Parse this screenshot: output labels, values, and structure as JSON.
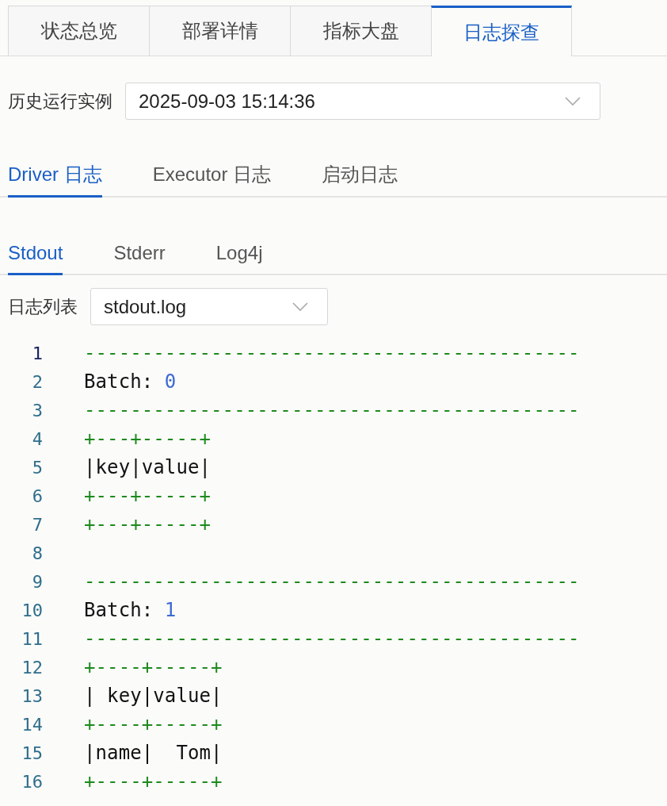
{
  "main_tabs": [
    {
      "label": "状态总览",
      "selected": false
    },
    {
      "label": "部署详情",
      "selected": false
    },
    {
      "label": "指标大盘",
      "selected": false
    },
    {
      "label": "日志探查",
      "selected": true
    }
  ],
  "instance_select": {
    "label": "历史运行实例",
    "value": "2025-09-03 15:14:36"
  },
  "log_tabs": [
    {
      "label": "Driver 日志",
      "selected": true
    },
    {
      "label": "Executor 日志",
      "selected": false
    },
    {
      "label": "启动日志",
      "selected": false
    }
  ],
  "stream_tabs": [
    {
      "label": "Stdout",
      "selected": true
    },
    {
      "label": "Stderr",
      "selected": false
    },
    {
      "label": "Log4j",
      "selected": false
    }
  ],
  "file_select": {
    "label": "日志列表",
    "value": "stdout.log"
  },
  "log_lines": [
    {
      "number": "1",
      "active": true,
      "segments": [
        {
          "kind": "rule",
          "text": "-------------------------------------------"
        }
      ]
    },
    {
      "number": "2",
      "active": false,
      "segments": [
        {
          "kind": "plain",
          "text": "Batch: "
        },
        {
          "kind": "number",
          "text": "0"
        }
      ]
    },
    {
      "number": "3",
      "active": false,
      "segments": [
        {
          "kind": "rule",
          "text": "-------------------------------------------"
        }
      ]
    },
    {
      "number": "4",
      "active": false,
      "segments": [
        {
          "kind": "rule",
          "text": "+---+-----+"
        }
      ]
    },
    {
      "number": "5",
      "active": false,
      "segments": [
        {
          "kind": "plain",
          "text": "|key|value|"
        }
      ]
    },
    {
      "number": "6",
      "active": false,
      "segments": [
        {
          "kind": "rule",
          "text": "+---+-----+"
        }
      ]
    },
    {
      "number": "7",
      "active": false,
      "segments": [
        {
          "kind": "rule",
          "text": "+---+-----+"
        }
      ]
    },
    {
      "number": "8",
      "active": false
    },
    {
      "number": "9",
      "active": false,
      "segments": [
        {
          "kind": "rule",
          "text": "-------------------------------------------"
        }
      ]
    },
    {
      "number": "10",
      "active": false,
      "segments": [
        {
          "kind": "plain",
          "text": "Batch: "
        },
        {
          "kind": "number",
          "text": "1"
        }
      ]
    },
    {
      "number": "11",
      "active": false,
      "segments": [
        {
          "kind": "rule",
          "text": "-------------------------------------------"
        }
      ]
    },
    {
      "number": "12",
      "active": false,
      "segments": [
        {
          "kind": "rule",
          "text": "+----+-----+"
        }
      ]
    },
    {
      "number": "13",
      "active": false,
      "segments": [
        {
          "kind": "plain",
          "text": "| key|value|"
        }
      ]
    },
    {
      "number": "14",
      "active": false,
      "segments": [
        {
          "kind": "rule",
          "text": "+----+-----+"
        }
      ]
    },
    {
      "number": "15",
      "active": false,
      "segments": [
        {
          "kind": "plain",
          "text": "|name|  Tom|"
        }
      ]
    },
    {
      "number": "16",
      "active": false,
      "segments": [
        {
          "kind": "rule",
          "text": "+----+-----+"
        }
      ]
    }
  ]
}
